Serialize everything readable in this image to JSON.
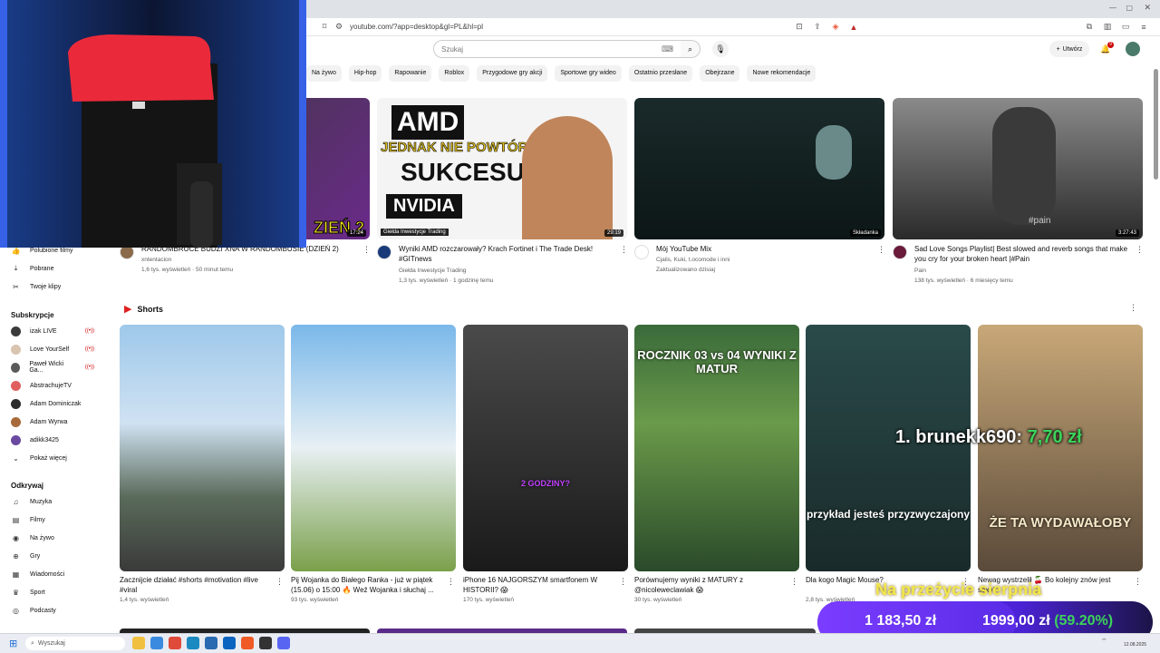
{
  "browser": {
    "url": "youtube.com/?app=desktop&gl=PL&hl=pl"
  },
  "header": {
    "search_placeholder": "Szukaj",
    "create_label": "Utwórz",
    "notif_count": "9"
  },
  "chips": [
    "Na żywo",
    "Hip-hop",
    "Rapowanie",
    "Roblox",
    "Przygodowe gry akcji",
    "Sportowe gry wideo",
    "Ostatnio przesłane",
    "Obejrzane",
    "Nowe rekomendacje"
  ],
  "sidebar": {
    "you_items": [
      {
        "icon": "liked-icon",
        "label": "Polubione filmy"
      },
      {
        "icon": "download-icon",
        "label": "Pobrane"
      },
      {
        "icon": "scissors-icon",
        "label": "Twoje klipy"
      }
    ],
    "subs_title": "Subskrypcje",
    "subs": [
      {
        "label": "izak LIVE",
        "live": true,
        "color": "#3a3a3a"
      },
      {
        "label": "Love YourSelf",
        "live": true,
        "color": "#d9c4b0"
      },
      {
        "label": "Paweł Wicki Ga...",
        "live": true,
        "color": "#5a5a5a"
      },
      {
        "label": "AbstrachujeTV",
        "live": false,
        "color": "#e06060"
      },
      {
        "label": "Adam Dominiczak",
        "live": false,
        "color": "#2c2c2c"
      },
      {
        "label": "Adam Wyrwa",
        "live": false,
        "color": "#a86a3a"
      },
      {
        "label": "adikk3425",
        "live": false,
        "color": "#6a4aa0"
      }
    ],
    "show_more": "Pokaż więcej",
    "explore_title": "Odkrywaj",
    "explore": [
      {
        "icon": "music-icon",
        "label": "Muzyka"
      },
      {
        "icon": "film-icon",
        "label": "Filmy"
      },
      {
        "icon": "live-icon",
        "label": "Na żywo"
      },
      {
        "icon": "gamepad-icon",
        "label": "Gry"
      },
      {
        "icon": "news-icon",
        "label": "Wiadomości"
      },
      {
        "icon": "trophy-icon",
        "label": "Sport"
      },
      {
        "icon": "podcast-icon",
        "label": "Podcasty"
      }
    ]
  },
  "videos": [
    {
      "title": "RANDOMBRUCE BUDZI XNA W RANDOMBUSIE (DZIEŃ 2)",
      "channel": "xntentacion",
      "meta": "1,6 tys. wyświetleń · 50 minut temu",
      "duration": "17:24",
      "thumb_text": "ZIEŃ 2"
    },
    {
      "title": "Wyniki AMD rozczarowały? Krach Fortinet i The Trade Desk! #GITnews",
      "channel": "Giełda Inwestycje Trading",
      "meta": "1,3 tys. wyświetleń · 1 godzinę temu",
      "duration": "29:19",
      "thumb_text_1": "AMD",
      "thumb_text_2": "JEDNAK NIE POWTÓRZY",
      "thumb_text_3": "SUKCESU",
      "thumb_text_4": "NVIDIA",
      "thumb_brand": "Giełda Inwestycje Trading"
    },
    {
      "title": "Mój YouTube Mix",
      "channel": "Cjalis, Kuki, t.ocomode i inni",
      "meta": "Zaktualizowano dzisiaj",
      "duration": "Składanka"
    },
    {
      "title": "Sad Love Songs Playlist| Best slowed and reverb songs that make you cry for your broken heart |#Pain",
      "channel": "Pain",
      "meta": "138 tys. wyświetleń · 6 miesięcy temu",
      "duration": "3:27:43",
      "thumb_text": "#pain"
    }
  ],
  "shorts_title": "Shorts",
  "shorts": [
    {
      "title": "Zacznijcie działać #shorts #motivation #live #viral",
      "meta": "1,4 tys. wyświetleń"
    },
    {
      "title": "Pij Wojanka do Białego Ranka - już w piątek (15.06) o 15:00 🔥 Weź Wojanka i słuchaj ...",
      "meta": "93 tys. wyświetleń"
    },
    {
      "title": "iPhone 16 NAJGORSZYM smartfonem W HISTORII? 😱",
      "meta": "170 tys. wyświetleń",
      "overlay": "2 GODZINY?"
    },
    {
      "title": "Porównujemy wyniki z MATURY z @nicoleweclawiak 😱",
      "meta": "30 tys. wyświetleń",
      "overlay": "ROCZNIK 03 vs 04 WYNIKI Z MATUR"
    },
    {
      "title": "Dla kogo Magic Mouse?",
      "meta": "2,8 tys. wyświetleń",
      "overlay": "przykład jesteś przyzwyczajony"
    },
    {
      "title": "Newag wystrzelił 🍒 Bo kolejny znów jest sexy!",
      "meta": "",
      "overlay": "ŻE TA WYDAWAŁOBY"
    }
  ],
  "stream_overlay": {
    "donor": "1. brunekk690:",
    "donor_amount": "7,70 zł",
    "goal_title": "Na przeżycie sierpnia",
    "current": "1 183,50 zł",
    "target": "1999,00 zł",
    "percent": "(59.20%)",
    "progress": 0.592
  },
  "taskbar": {
    "search_placeholder": "Wyszukaj",
    "date": "12.08.2025"
  },
  "colors": {
    "accent": "#cc0000",
    "donation_purple": "#5a2ce6",
    "donor_green": "#3cd35a",
    "goal_yellow": "#f2e84a"
  }
}
